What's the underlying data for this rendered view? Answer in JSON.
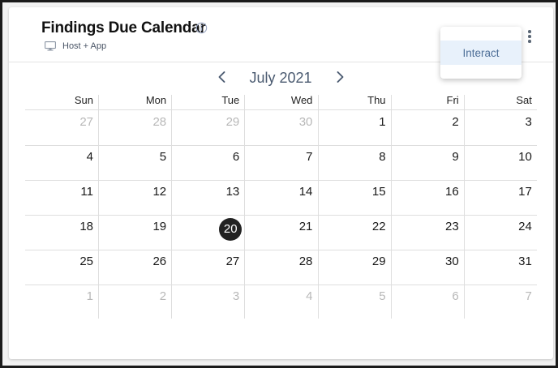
{
  "widget": {
    "title": "Findings Due Calendar",
    "subtitle": "Host + App",
    "info_icon": "info-circle-icon",
    "subtitle_icon": "monitor-icon",
    "menu_icon": "kebab-menu-icon"
  },
  "menu": {
    "items": [
      {
        "label": "Interact"
      }
    ]
  },
  "calendar": {
    "month_label": "July 2021",
    "weekday_headers": [
      "Sun",
      "Mon",
      "Tue",
      "Wed",
      "Thu",
      "Fri",
      "Sat"
    ],
    "selected_day": "20",
    "weeks": [
      [
        {
          "d": "27",
          "muted": true
        },
        {
          "d": "28",
          "muted": true
        },
        {
          "d": "29",
          "muted": true
        },
        {
          "d": "30",
          "muted": true
        },
        {
          "d": "1",
          "muted": false
        },
        {
          "d": "2",
          "muted": false
        },
        {
          "d": "3",
          "muted": false
        }
      ],
      [
        {
          "d": "4",
          "muted": false
        },
        {
          "d": "5",
          "muted": false
        },
        {
          "d": "6",
          "muted": false
        },
        {
          "d": "7",
          "muted": false
        },
        {
          "d": "8",
          "muted": false
        },
        {
          "d": "9",
          "muted": false
        },
        {
          "d": "10",
          "muted": false
        }
      ],
      [
        {
          "d": "11",
          "muted": false
        },
        {
          "d": "12",
          "muted": false
        },
        {
          "d": "13",
          "muted": false
        },
        {
          "d": "14",
          "muted": false
        },
        {
          "d": "15",
          "muted": false
        },
        {
          "d": "16",
          "muted": false
        },
        {
          "d": "17",
          "muted": false
        }
      ],
      [
        {
          "d": "18",
          "muted": false
        },
        {
          "d": "19",
          "muted": false
        },
        {
          "d": "20",
          "muted": false,
          "today": true
        },
        {
          "d": "21",
          "muted": false
        },
        {
          "d": "22",
          "muted": false
        },
        {
          "d": "23",
          "muted": false
        },
        {
          "d": "24",
          "muted": false
        }
      ],
      [
        {
          "d": "25",
          "muted": false
        },
        {
          "d": "26",
          "muted": false
        },
        {
          "d": "27",
          "muted": false
        },
        {
          "d": "28",
          "muted": false
        },
        {
          "d": "29",
          "muted": false
        },
        {
          "d": "30",
          "muted": false
        },
        {
          "d": "31",
          "muted": false
        }
      ],
      [
        {
          "d": "1",
          "muted": true
        },
        {
          "d": "2",
          "muted": true
        },
        {
          "d": "3",
          "muted": true
        },
        {
          "d": "4",
          "muted": true
        },
        {
          "d": "5",
          "muted": true
        },
        {
          "d": "6",
          "muted": true
        },
        {
          "d": "7",
          "muted": true
        }
      ]
    ]
  },
  "colors": {
    "selected_day_bg": "#222222",
    "menu_highlight": "#e8f1fb",
    "accent_text": "#4e6f98"
  }
}
